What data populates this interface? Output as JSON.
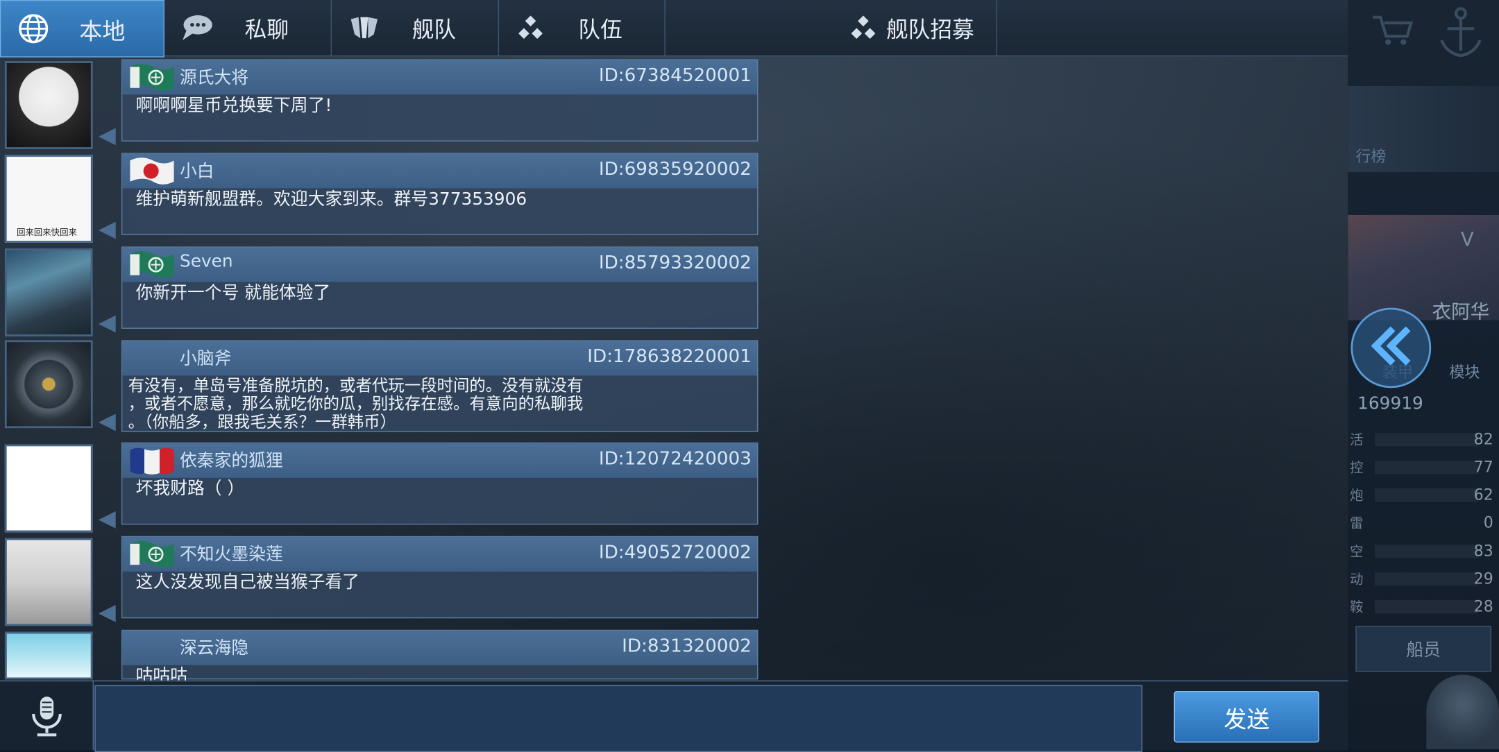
{
  "tabs": [
    {
      "label": "本地",
      "icon": "globe-icon",
      "active": true
    },
    {
      "label": "私聊",
      "icon": "chat-bubble-icon",
      "active": false
    },
    {
      "label": "舰队",
      "icon": "fleet-shield-icon",
      "active": false
    },
    {
      "label": "队伍",
      "icon": "team-dots-icon",
      "active": false
    },
    {
      "label": "舰队招募",
      "icon": "team-dots-icon",
      "active": false
    }
  ],
  "messages": [
    {
      "name": "源氏大将",
      "id": "ID:67384520001",
      "text": "啊啊啊星币兑换要下周了!",
      "flag": "green-flag"
    },
    {
      "name": "小白",
      "id": "ID:69835920002",
      "text": "维护萌新舰盟群。欢迎大家到来。群号377353906",
      "flag": "japan-flag"
    },
    {
      "name": "Seven",
      "id": "ID:85793320002",
      "text": "你新开一个号 就能体验了",
      "flag": "green-flag"
    },
    {
      "name": "小脑斧",
      "id": "ID:178638220001",
      "text": "有没有，单岛号准备脱坑的，或者代玩一段时间的。没有就没有\n，或者不愿意，那么就吃你的瓜，别找存在感。有意向的私聊我\n。（你船多，跟我毛关系？一群韩币）",
      "flag": ""
    },
    {
      "name": "依秦家的狐狸",
      "id": "ID:12072420003",
      "text": "坏我财路（ ）",
      "flag": "france-flag"
    },
    {
      "name": "不知火墨染莲",
      "id": "ID:49052720002",
      "text": "这人没发现自己被当猴子看了",
      "flag": "green-flag"
    },
    {
      "name": "深云海隐",
      "id": "ID:831320002",
      "text": "咕咕咕",
      "flag": ""
    }
  ],
  "avatar_caption": "回来回来快回来",
  "input": {
    "value": "",
    "placeholder": ""
  },
  "send_label": "发送",
  "right_panel": {
    "rank_label": "行榜",
    "ship_name": "衣阿华",
    "armor_label": "装甲",
    "module_label": "模块",
    "power": "169919",
    "stats": [
      {
        "label": "活",
        "value": "82"
      },
      {
        "label": "控",
        "value": "77"
      },
      {
        "label": "炮",
        "value": "62"
      },
      {
        "label": "雷",
        "value": "0"
      },
      {
        "label": "空",
        "value": "83"
      },
      {
        "label": "动",
        "value": "29"
      },
      {
        "label": "鞍",
        "value": "28"
      }
    ],
    "crew_label": "船员",
    "level_label": "V"
  },
  "colors": {
    "accent": "#3d86c8",
    "panel": "#32465f",
    "header": "#456a92"
  }
}
